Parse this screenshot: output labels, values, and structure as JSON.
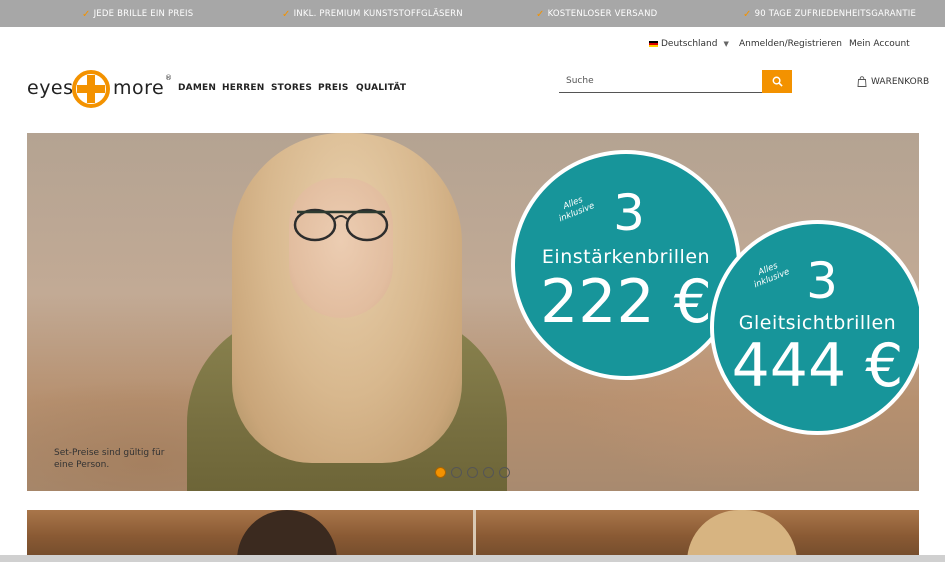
{
  "usp_bar": [
    {
      "text": "JEDE BRILLE EIN PREIS"
    },
    {
      "text": "INKL. PREMIUM KUNSTSTOFFGLÄSERN"
    },
    {
      "text": "KOSTENLOSER VERSAND"
    },
    {
      "text": "90 TAGE ZUFRIEDENHEITSGARANTIE"
    }
  ],
  "subnav": {
    "country": "Deutschland",
    "login": "Anmelden/Registrieren",
    "account": "Mein Account"
  },
  "logo": {
    "left": "eyes",
    "right": "more",
    "reg": "®"
  },
  "mainnav": [
    "DAMEN",
    "HERREN",
    "STORES",
    "PREIS",
    "QUALITÄT"
  ],
  "search": {
    "placeholder": "Suche"
  },
  "cart": {
    "label": "WARENKORB"
  },
  "hero": {
    "offer1": {
      "alles": "Alles inklusive",
      "count": "3",
      "type": "Einstärkenbrillen",
      "price": "222 €"
    },
    "offer2": {
      "alles": "Alles inklusive",
      "count": "3",
      "type": "Gleitsichtbrillen",
      "price": "444 €"
    },
    "disclaimer": "Set-Preise sind gültig für eine Person.",
    "slides_total": 5,
    "active_slide": 1
  },
  "colors": {
    "accent": "#f39200",
    "teal": "#17959a",
    "topbar": "#a7a7a7"
  }
}
